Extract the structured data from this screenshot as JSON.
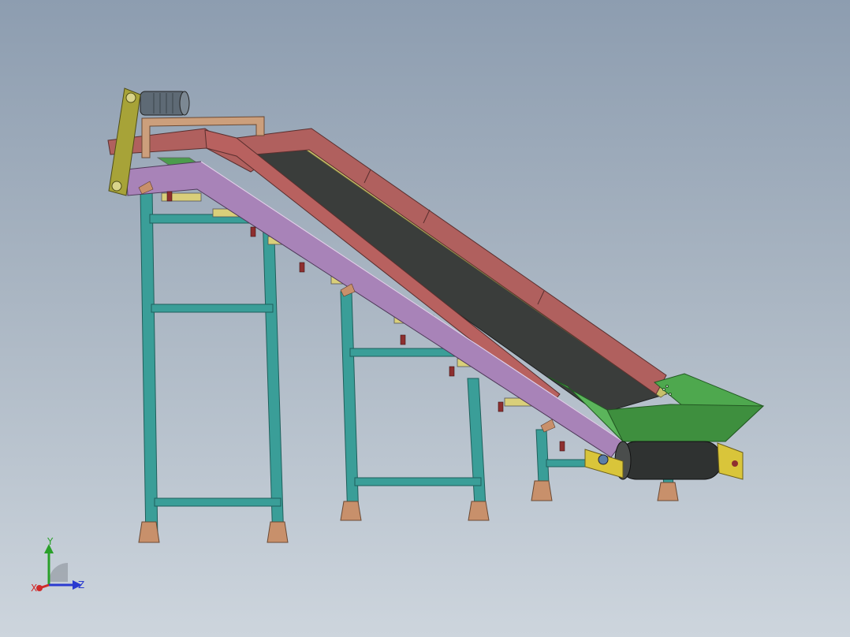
{
  "viewport": {
    "background_top": "#8d9db0",
    "background_bottom": "#cdd5dd"
  },
  "colors": {
    "frame_legs": "#3a9e98",
    "side_rail": "#a883b8",
    "belt": "#3a3d3b",
    "top_guard": "#b0605e",
    "inner_strip": "#c7c06a",
    "hopper": "#4ea84e",
    "drive_arm": "#a7a338",
    "motor": "#5e6a75",
    "motor_mount": "#cc9f7c",
    "roller_gold": "#d9cf7a",
    "roller_green": "#3f9a3a",
    "bracket_red": "#8e2f2f",
    "feet": "#c8906b",
    "tail_bracket": "#d9c53a"
  },
  "triad": {
    "x_label": "X",
    "y_label": "Y",
    "z_label": "Z",
    "x_color": "#d02a2a",
    "y_color": "#2aa02a",
    "z_color": "#2a3ad0"
  }
}
